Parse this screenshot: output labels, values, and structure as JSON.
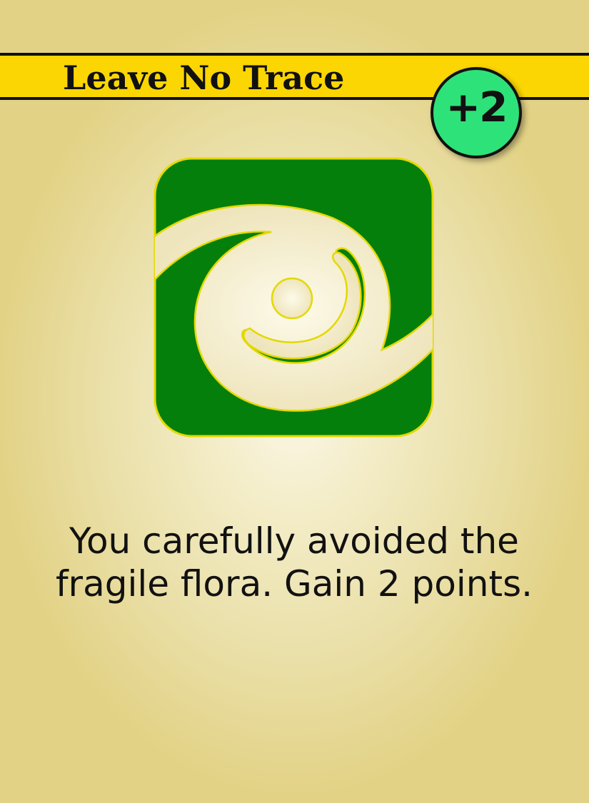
{
  "card": {
    "title": "Leave No Trace",
    "points": "+2",
    "icon": "spiral-swirl-icon",
    "description": "You carefully avoided the fragile flora. Gain 2 points."
  },
  "colors": {
    "background": "#ebe1ac",
    "title_bar": "#fbd602",
    "badge": "#2ee27a",
    "icon_green": "#057f0c",
    "icon_outline": "#e3d900",
    "text": "#111111"
  }
}
